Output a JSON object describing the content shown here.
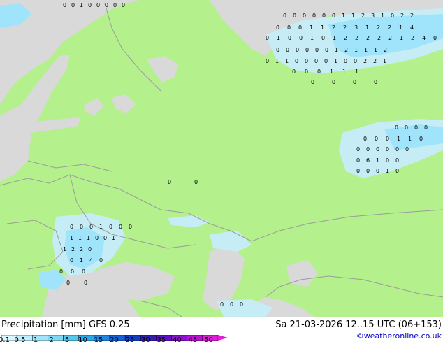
{
  "footer": {
    "title_label": "Precipitation [mm]",
    "model": "GFS",
    "resolution": "0.25",
    "valid_time": "Sa 21-03-2026 12..15 UTC (06+153)",
    "credit": "©weatheronline.co.uk"
  },
  "legend": {
    "ticks": [
      "0.1",
      "0.5",
      "1",
      "2",
      "5",
      "10",
      "15",
      "20",
      "25",
      "30",
      "35",
      "40",
      "45",
      "50"
    ],
    "colors": [
      "#d9f6ff",
      "#bfeeff",
      "#9fe4fb",
      "#7fd9f5",
      "#55c8ee",
      "#2aa8e8",
      "#1e88e0",
      "#1464d8",
      "#1040c8",
      "#3020b0",
      "#6010c8",
      "#9010d8",
      "#c010d8",
      "#e020d8"
    ]
  },
  "map_colors": {
    "land": "#b4f08c",
    "sea": "#d9d9d9",
    "border": "#9c9c9c",
    "precip_light": "#c6ecf6",
    "precip_mid": "#9fe4fb",
    "precip_heavy": "#55c8ee",
    "label": "#000000"
  },
  "precip_labels": [
    {
      "row": 6,
      "items": [
        "0",
        "0",
        "1",
        "0",
        "0",
        "0",
        "0",
        "0"
      ]
    },
    {
      "row": 21,
      "items": [
        "0",
        "0",
        "0",
        "0",
        "0",
        "0",
        "1",
        "1",
        "2",
        "3",
        "1",
        "0",
        "2",
        "2"
      ]
    },
    {
      "row": 38,
      "items": [
        "0",
        "0",
        "0",
        "1",
        "1",
        "2",
        "2",
        "3",
        "1",
        "2",
        "2",
        "1",
        "4"
      ]
    },
    {
      "row": 53,
      "items": [
        "0",
        "1",
        "0",
        "0",
        "1",
        "0",
        "1",
        "2",
        "2",
        "2",
        "2",
        "2",
        "1",
        "2",
        "4",
        "0"
      ]
    },
    {
      "row": 70,
      "items": [
        "0",
        "0",
        "0",
        "0",
        "0",
        "0",
        "1",
        "2",
        "1",
        "1",
        "1",
        "2"
      ]
    },
    {
      "row": 86,
      "items": [
        "0",
        "1",
        "1",
        "0",
        "0",
        "0",
        "0",
        "1",
        "0",
        "0",
        "2",
        "2",
        "1"
      ]
    },
    {
      "row": 101,
      "items": [
        "0",
        "0",
        "0",
        "1",
        "1",
        "1"
      ]
    },
    {
      "row": 116,
      "items": [
        "0",
        "0",
        "0",
        "0"
      ]
    },
    {
      "row": 181,
      "items": [
        "0",
        "0",
        "0",
        "0"
      ]
    },
    {
      "row": 197,
      "items": [
        "0",
        "0",
        "0",
        "1",
        "1",
        "0"
      ]
    },
    {
      "row": 212,
      "items": [
        "0",
        "0",
        "0",
        "0",
        "0",
        "0"
      ]
    },
    {
      "row": 228,
      "items": [
        "0",
        "6",
        "1",
        "0",
        "0"
      ]
    },
    {
      "row": 243,
      "items": [
        "0",
        "0",
        "0",
        "1",
        "0"
      ]
    },
    {
      "row": 259,
      "items": [
        "0",
        "0"
      ]
    },
    {
      "row": 323,
      "items": [
        "0",
        "0",
        "0",
        "1",
        "0",
        "0",
        "0"
      ]
    },
    {
      "row": 339,
      "items": [
        "1",
        "1",
        "1",
        "0",
        "0",
        "1"
      ]
    },
    {
      "row": 355,
      "items": [
        "1",
        "2",
        "2",
        "0"
      ]
    },
    {
      "row": 371,
      "items": [
        "0",
        "1",
        "4",
        "0"
      ]
    },
    {
      "row": 387,
      "items": [
        "0",
        "0",
        "0"
      ]
    },
    {
      "row": 403,
      "items": [
        "0",
        "0"
      ]
    },
    {
      "row": 434,
      "items": [
        "0",
        "0",
        "0"
      ]
    }
  ]
}
